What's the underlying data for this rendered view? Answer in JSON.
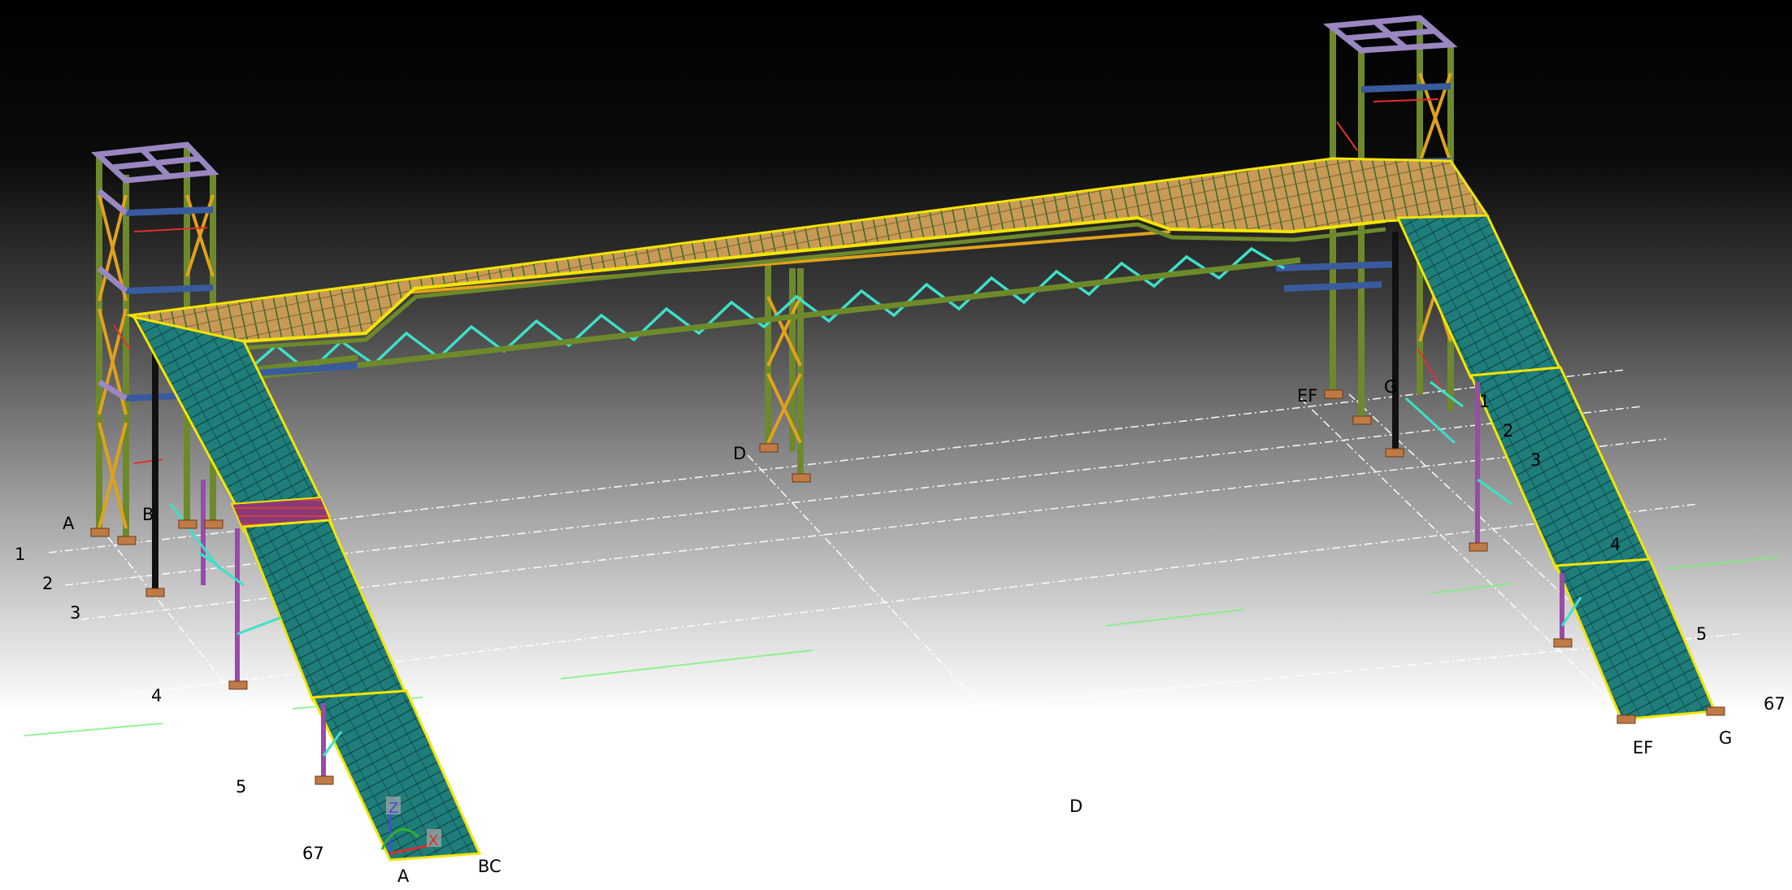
{
  "viewport": {
    "background_top": "#000000",
    "background_bottom": "#ffffff"
  },
  "colors": {
    "deck_top": "#c99a55",
    "deck_grating_line": "#2f6b2f",
    "stair_tread": "#1f7d7a",
    "stair_line": "#0a3c3c",
    "stringer_yellow": "#f5e400",
    "column_green": "#6d8a2a",
    "bracing_orange": "#e0a21a",
    "truss_cyan": "#3ee0c8",
    "beam_blue": "#3a5a9e",
    "beam_lavender": "#9a86c0",
    "post_purple": "#9a4aa8",
    "column_black": "#111111",
    "baseplate": "#c07a45",
    "grid_line": "#ffffff",
    "green_trace": "#7cf07c",
    "red_member": "#e03030"
  },
  "grid_labels": {
    "a_left": "A",
    "b_left": "B",
    "a_bottom": "A",
    "bc_bottom": "BC",
    "d_mid": "D",
    "d_bottom": "D",
    "ef_mid": "EF",
    "g_mid": "G",
    "ef_right": "EF",
    "g_right": "G",
    "n1_left": "1",
    "n2_left": "2",
    "n3_left": "3",
    "n4_left": "4",
    "n5_left": "5",
    "n67_left": "67",
    "n1_right": "1",
    "n2_right": "2",
    "n3_right": "3",
    "n4_right": "4",
    "n5_right": "5",
    "n67_right": "67"
  },
  "axis_triad": {
    "z_label": "Z",
    "x_label": "X",
    "z_color": "#4a4ad8",
    "x_color": "#d83030",
    "y_color": "#30b030"
  }
}
